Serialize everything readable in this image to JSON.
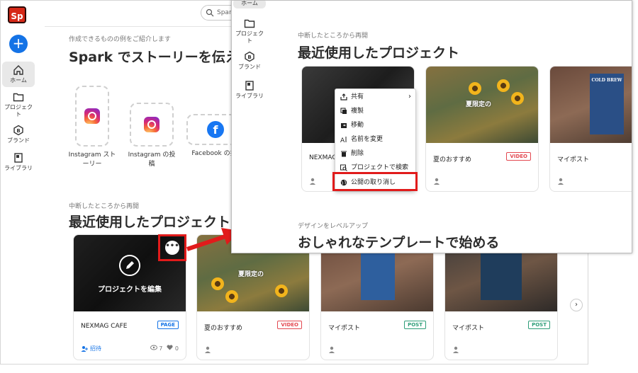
{
  "colors": {
    "accent": "#1473e6",
    "highlight": "#e11b1b",
    "logo": "#d62918"
  },
  "app": {
    "logo_text": "Sp",
    "create_label": "+"
  },
  "sidebar": {
    "items": [
      {
        "label": "ホーム",
        "icon": "home-icon"
      },
      {
        "label": "プロジェクト",
        "icon": "folder-icon"
      },
      {
        "label": "ブランド",
        "icon": "brand-icon"
      },
      {
        "label": "ライブラリ",
        "icon": "library-icon"
      }
    ]
  },
  "search": {
    "placeholder": "Spark"
  },
  "background": {
    "templates_subtitle": "作成できるものの例をご紹介します",
    "templates_title": "Spark でストーリーを伝え",
    "templates": [
      {
        "label_line1": "Instagram スト",
        "label_line2": "ーリー"
      },
      {
        "label_line1": "Instagram の投",
        "label_line2": "稿"
      },
      {
        "label_line1": "Facebook の投",
        "label_line2": ""
      }
    ],
    "recent_subtitle": "中断したところから再開",
    "recent_title": "最近使用したプロジェクト",
    "edit_label": "プロジェクトを編集",
    "more_label": "•••",
    "projects": [
      {
        "title": "NEXMAG CAFE",
        "badge": "PAGE",
        "invite": "招待",
        "views": "7",
        "likes": "0"
      },
      {
        "title": "夏のおすすめ",
        "badge": "VIDEO",
        "caption": "夏限定の"
      },
      {
        "title": "マイポスト",
        "badge": "POST"
      },
      {
        "title": "マイポスト",
        "badge": "POST"
      }
    ],
    "scroll_next": "›"
  },
  "foreground": {
    "sidebar_top_label": "ホーム",
    "recent_subtitle": "中断したところから再開",
    "recent_title": "最近使用したプロジェクト",
    "projects": [
      {
        "title": "NEXMAG",
        "badge": ""
      },
      {
        "title": "夏のおすすめ",
        "badge": "VIDEO",
        "caption": "夏限定の"
      },
      {
        "title": "マイポスト",
        "badge": ""
      }
    ],
    "poster_text": "COLD BREW",
    "menu": [
      {
        "label": "共有",
        "icon": "share-icon",
        "has_submenu": true
      },
      {
        "label": "複製",
        "icon": "duplicate-icon"
      },
      {
        "label": "移動",
        "icon": "move-icon"
      },
      {
        "label": "名前を変更",
        "icon": "rename-icon"
      },
      {
        "label": "削除",
        "icon": "trash-icon"
      },
      {
        "label": "プロジェクトで検索",
        "icon": "search-project-icon"
      },
      {
        "label": "公開の取り消し",
        "icon": "globe-icon"
      }
    ],
    "templates_subtitle": "デザインをレベルアップ",
    "templates_title": "おしゃれなテンプレートで始める"
  }
}
